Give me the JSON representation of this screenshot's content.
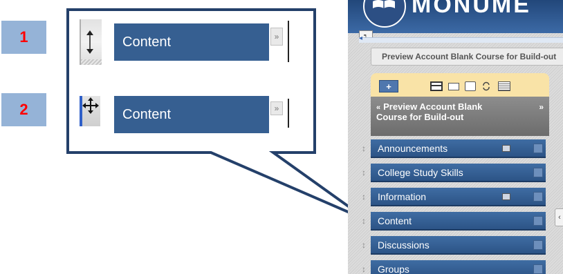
{
  "steps": [
    "1",
    "2"
  ],
  "zoom": {
    "row1_label": "Content",
    "row2_label": "Content",
    "toggle_glyph_1": "»",
    "toggle_glyph_2": "»"
  },
  "lms": {
    "site_title": "MONUME",
    "collapse_glyph": "┑",
    "breadcrumb": "Preview Account Blank Course for Build-out",
    "course_title": "Preview Account Blank Course for Build-out",
    "course_chevron": "«",
    "course_expand": "»",
    "add_label": "+",
    "side_tab_glyph": "‹",
    "menu_items": [
      {
        "label": "Announcements",
        "badge": true
      },
      {
        "label": "College Study Skills",
        "badge": false
      },
      {
        "label": "Information",
        "badge": true
      },
      {
        "label": "Content",
        "badge": false
      },
      {
        "label": "Discussions",
        "badge": false
      },
      {
        "label": "Groups",
        "badge": false
      }
    ]
  },
  "icons": {
    "vertical_handle": "vertical-drag-handle-icon",
    "move_handle": "move-cursor-icon"
  },
  "colors": {
    "badge_bg": "#95b3d7",
    "step_text": "#ff0000",
    "bar": "#365f91",
    "callout_stroke": "#24406a",
    "header": "#2c5486",
    "course_menu_bg": "#f9e3a7"
  }
}
